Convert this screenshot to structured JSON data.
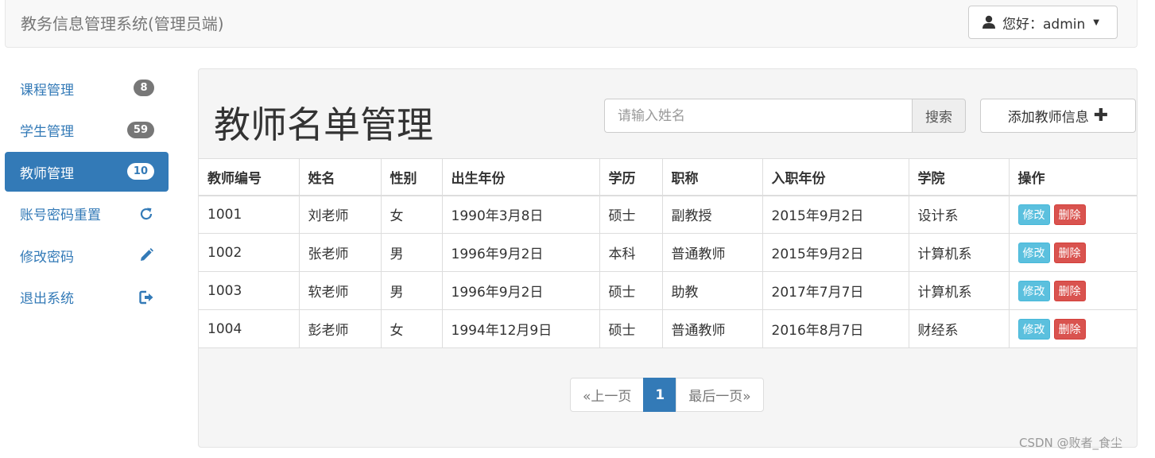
{
  "header": {
    "brand": "教务信息管理系统(管理员端)",
    "user_greeting": "您好：admin"
  },
  "sidebar": {
    "items": [
      {
        "label": "课程管理",
        "badge": "8"
      },
      {
        "label": "学生管理",
        "badge": "59"
      },
      {
        "label": "教师管理",
        "badge": "10",
        "active": true
      },
      {
        "label": "账号密码重置",
        "icon": "refresh-icon"
      },
      {
        "label": "修改密码",
        "icon": "pencil-icon"
      },
      {
        "label": "退出系统",
        "icon": "logout-icon"
      }
    ]
  },
  "main": {
    "title": "教师名单管理",
    "search_placeholder": "请输入姓名",
    "search_label": "搜索",
    "add_label": "添加教师信息"
  },
  "table": {
    "headers": [
      "教师编号",
      "姓名",
      "性别",
      "出生年份",
      "学历",
      "职称",
      "入职年份",
      "学院",
      "操作"
    ],
    "rows": [
      [
        "1001",
        "刘老师",
        "女",
        "1990年3月8日",
        "硕士",
        "副教授",
        "2015年9月2日",
        "设计系"
      ],
      [
        "1002",
        "张老师",
        "男",
        "1996年9月2日",
        "本科",
        "普通教师",
        "2015年9月2日",
        "计算机系"
      ],
      [
        "1003",
        "软老师",
        "男",
        "1996年9月2日",
        "硕士",
        "助教",
        "2017年7月7日",
        "计算机系"
      ],
      [
        "1004",
        "彭老师",
        "女",
        "1994年12月9日",
        "硕士",
        "普通教师",
        "2016年8月7日",
        "财经系"
      ]
    ],
    "edit_label": "修改",
    "delete_label": "删除"
  },
  "pagination": {
    "prev": "«上一页",
    "current": "1",
    "last": "最后一页»"
  },
  "watermark": "CSDN @败者_食尘",
  "colors": {
    "primary": "#337ab7",
    "info": "#5bc0de",
    "danger": "#d9534f"
  }
}
